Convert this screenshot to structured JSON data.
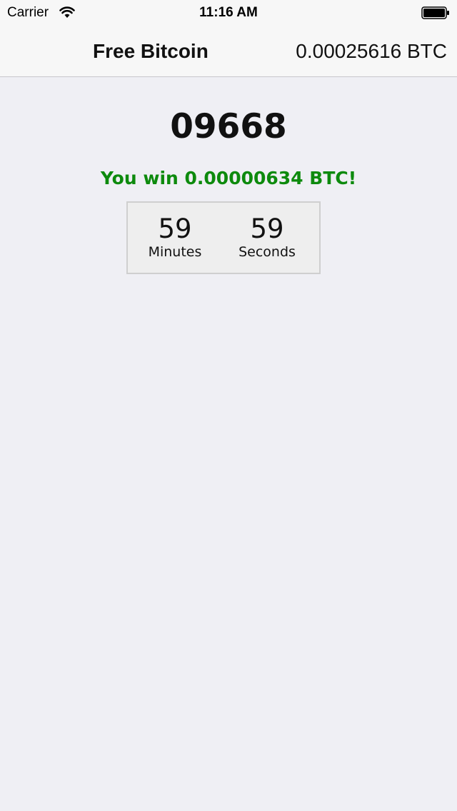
{
  "status_bar": {
    "carrier": "Carrier",
    "time": "11:16 AM",
    "wifi_icon": "wifi-icon",
    "battery_icon": "battery-icon"
  },
  "nav": {
    "title": "Free Bitcoin",
    "balance": "0.00025616 BTC"
  },
  "main": {
    "roll_number": "09668",
    "win_message": "You win 0.00000634 BTC!",
    "timer": {
      "minutes_value": "59",
      "minutes_label": "Minutes",
      "seconds_value": "59",
      "seconds_label": "Seconds"
    }
  },
  "colors": {
    "background": "#efeff4",
    "header": "#f7f7f7",
    "win_text": "#0d8a0d"
  }
}
